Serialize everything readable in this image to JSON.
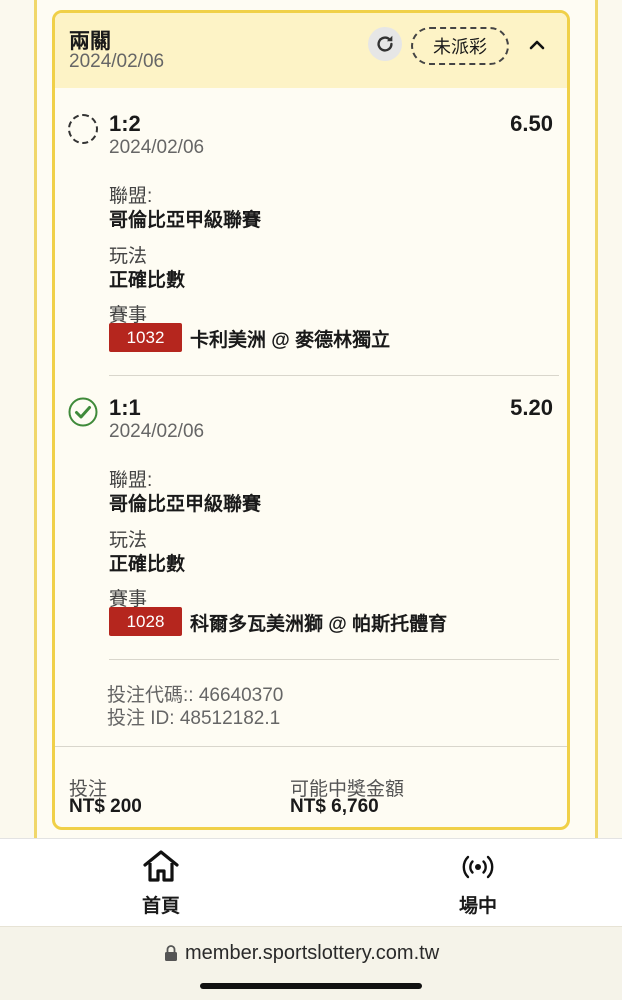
{
  "card": {
    "title": "兩關",
    "date": "2024/02/06",
    "status": "未派彩"
  },
  "selections": [
    {
      "result": "1:2",
      "odds": "6.50",
      "date": "2024/02/06",
      "status_icon": "pending-dashed-circle-icon",
      "league_label": "聯盟:",
      "league": "哥倫比亞甲級聯賽",
      "market_label": "玩法",
      "market": "正確比數",
      "event_label": "賽事",
      "match_no": "1032",
      "match": "卡利美洲 @ 麥德林獨立"
    },
    {
      "result": "1:1",
      "odds": "5.20",
      "date": "2024/02/06",
      "status_icon": "check-circle-icon",
      "league_label": "聯盟:",
      "league": "哥倫比亞甲級聯賽",
      "market_label": "玩法",
      "market": "正確比數",
      "event_label": "賽事",
      "match_no": "1028",
      "match": "科爾多瓦美洲獅 @ 帕斯托體育"
    }
  ],
  "meta": {
    "bet_code": "投注代碼:: 46640370",
    "bet_id": "投注 ID: 48512182.1"
  },
  "footer": {
    "stake_label": "投注",
    "stake": "NT$ 200",
    "payout_label": "可能中獎金額",
    "payout": "NT$ 6,760"
  },
  "nav": {
    "home_label": "首頁",
    "live_label": "場中"
  },
  "browser": {
    "url": "member.sportslottery.com.tw"
  },
  "colors": {
    "accent_yellow": "#f0d048",
    "header_bg": "#fdf3c6",
    "badge_red": "#b5261e",
    "check_green": "#3f8a3a"
  }
}
